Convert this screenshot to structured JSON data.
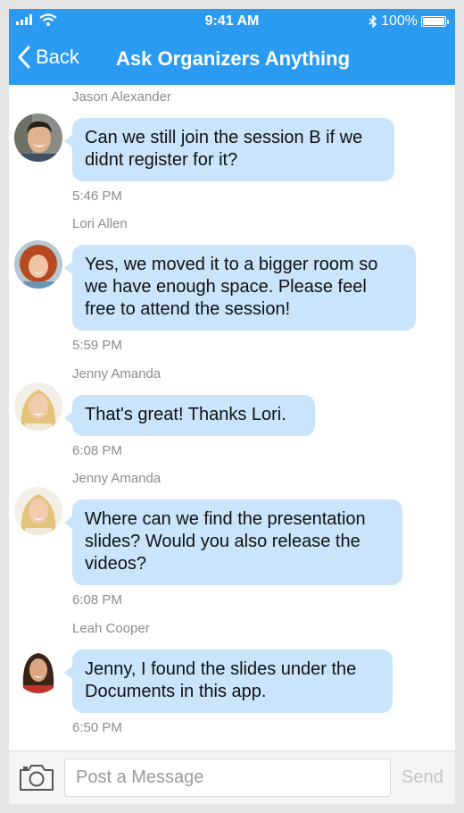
{
  "status_bar": {
    "time": "9:41 AM",
    "battery": "100%",
    "battery_level": 1.0
  },
  "nav": {
    "back_label": "Back",
    "title": "Ask Organizers Anything"
  },
  "messages": [
    {
      "sender": "Jason Alexander",
      "lines": [
        "Can we still join the session B if we",
        "didnt register for it?"
      ],
      "time": "5:46 PM",
      "avatar": "man-avatar"
    },
    {
      "sender": "Lori Allen",
      "lines": [
        "Yes, we moved it to a bigger room so",
        "we have enough space. Please feel",
        "free to attend the session!"
      ],
      "time": "5:59 PM",
      "avatar": "redhead-woman-avatar"
    },
    {
      "sender": "Jenny Amanda",
      "lines": [
        "That's great! Thanks Lori."
      ],
      "time": "6:08 PM",
      "avatar": "blonde-woman-avatar"
    },
    {
      "sender": "Jenny Amanda",
      "lines": [
        "Where can we find the presentation",
        "slides? Would you also release the",
        "videos?"
      ],
      "time": "6:08 PM",
      "avatar": "blonde-woman-avatar"
    },
    {
      "sender": "Leah Cooper",
      "lines": [
        "Jenny, I found the slides under the",
        "Documents in this app."
      ],
      "time": "6:50 PM",
      "avatar": "dark-hair-woman-avatar"
    }
  ],
  "composer": {
    "placeholder": "Post a Message",
    "value": "",
    "send_label": "Send"
  },
  "colors": {
    "accent": "#2a9bf0",
    "bubble": "#c9e4fb",
    "meta_text": "#8c8c8c"
  }
}
